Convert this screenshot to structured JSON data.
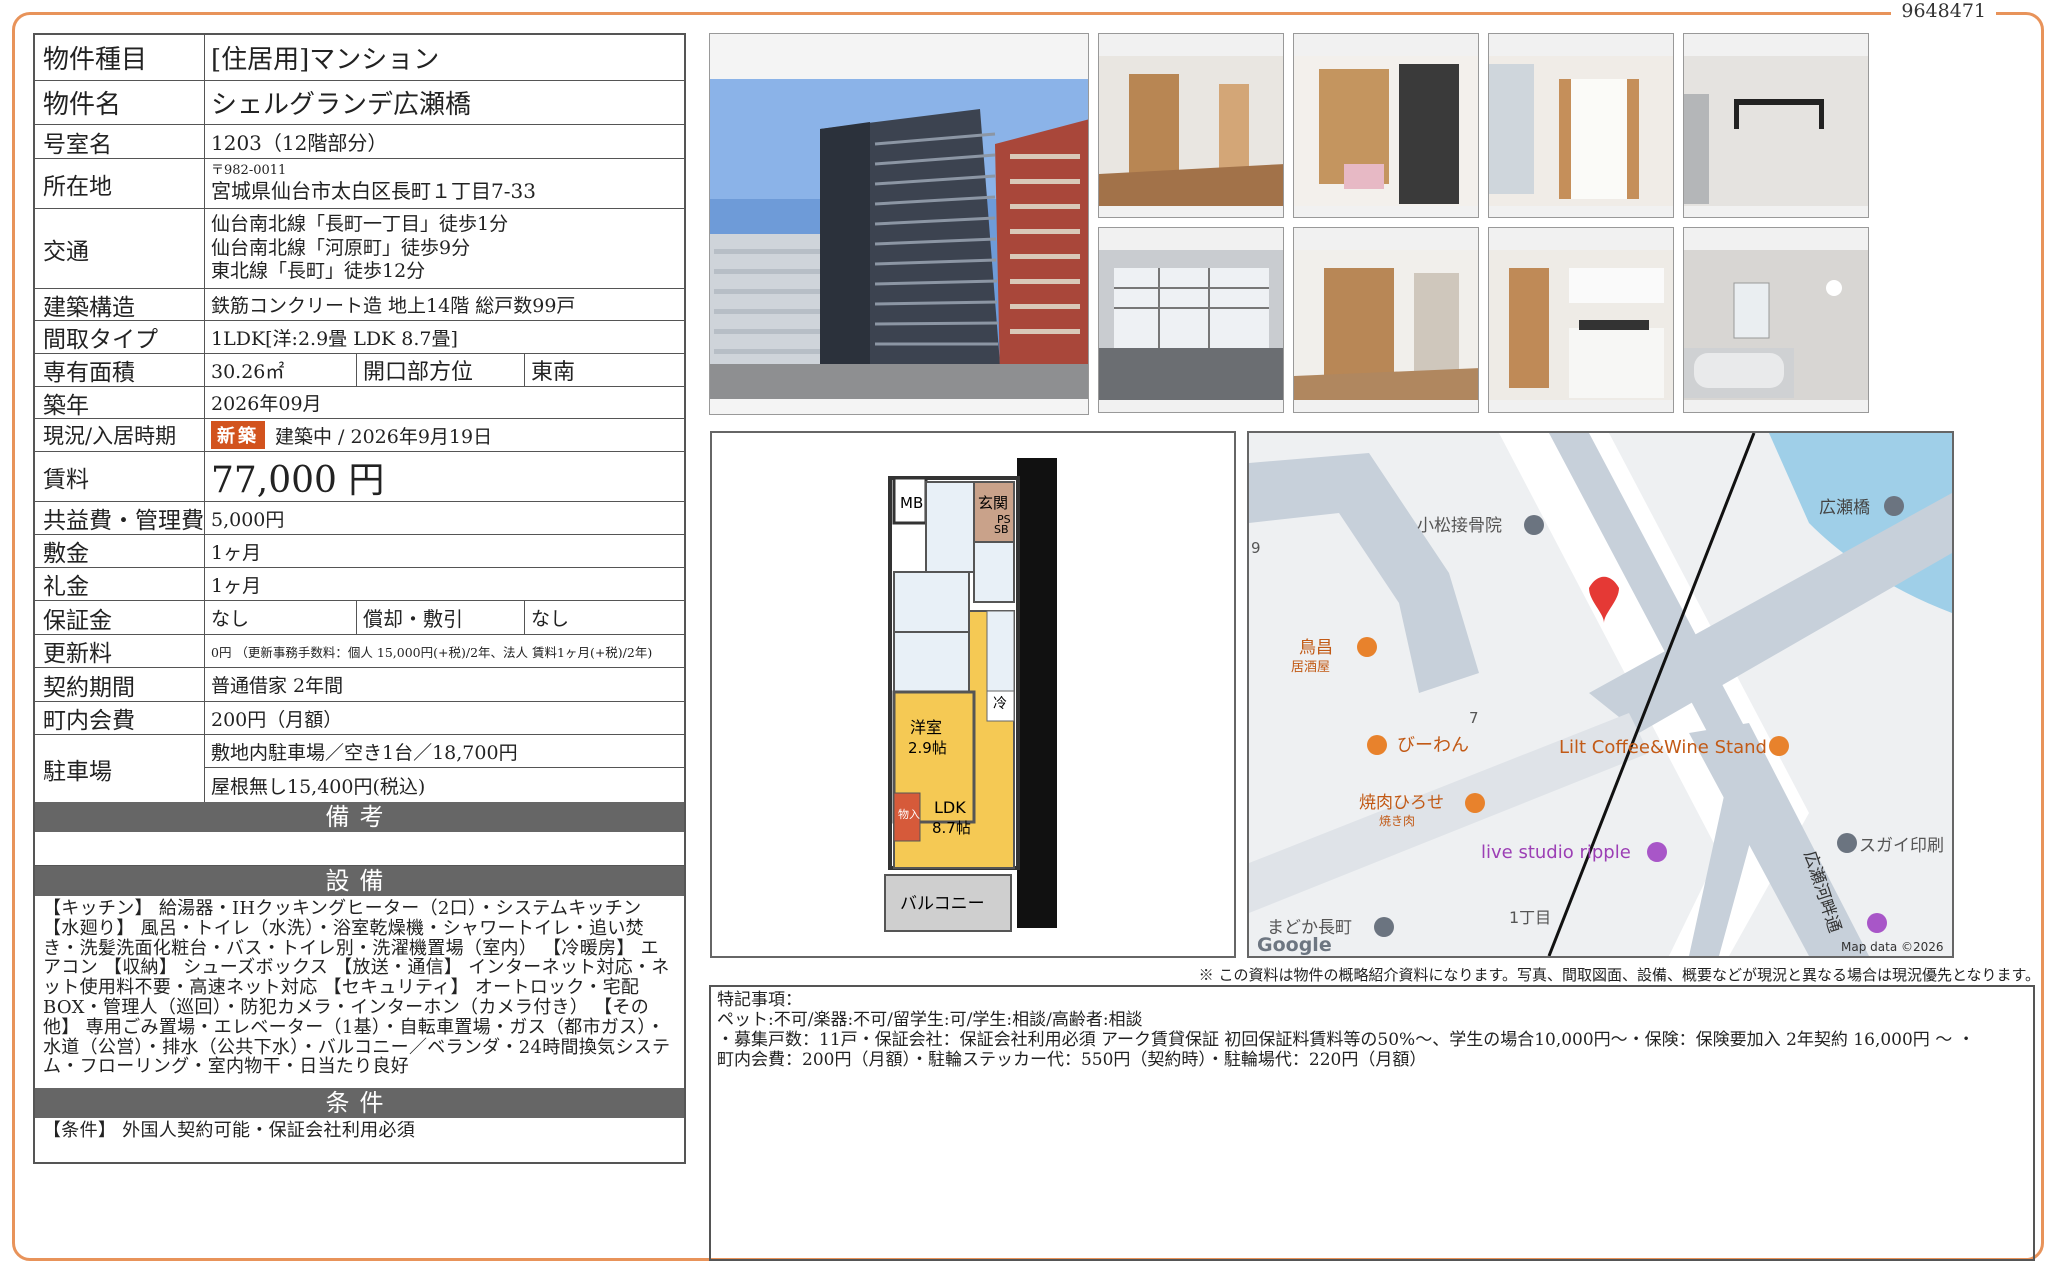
{
  "doc_id": "9648471",
  "property": {
    "type_label": "物件種目",
    "type_value": "[住居用]マンション",
    "name_label": "物件名",
    "name_value": "シェルグランデ広瀬橋",
    "room_label": "号室名",
    "room_value": "1203（12階部分）",
    "address_label": "所在地",
    "address_zip": "〒982-0011",
    "address_value": "宮城県仙台市太白区長町１丁目7-33",
    "access_label": "交通",
    "access_lines": [
      "仙台南北線「長町一丁目」徒歩1分",
      "仙台南北線「河原町」徒歩9分",
      "東北線「長町」徒歩12分"
    ],
    "structure_label": "建築構造",
    "structure_value": "鉄筋コンクリート造 地上14階 総戸数99戸",
    "layout_label": "間取タイプ",
    "layout_value": "1LDK[洋:2.9畳 LDK 8.7畳]",
    "area_label": "専有面積",
    "area_value": "30.26㎡",
    "direction_label": "開口部方位",
    "direction_value": "東南",
    "built_label": "築年",
    "built_value": "2026年09月",
    "status_label": "現況/入居時期",
    "status_badge": "新築",
    "status_value": "建築中 / 2026年9月19日",
    "rent_label": "賃料",
    "rent_value": "77,000 円",
    "fee_label": "共益費・管理費",
    "fee_value": "5,000円",
    "deposit_label": "敷金",
    "deposit_value": "1ヶ月",
    "key_label": "礼金",
    "key_value": "1ヶ月",
    "guarantee_label": "保証金",
    "guarantee_value": "なし",
    "amort_label": "償却・敷引",
    "amort_value": "なし",
    "renew_label": "更新料",
    "renew_value": "0円 （更新事務手数料：個人 15,000円(+税)/2年、法人 賃料1ヶ月(+税)/2年)",
    "contract_label": "契約期間",
    "contract_value": "普通借家 2年間",
    "town_label": "町内会費",
    "town_value": "200円（月額）",
    "parking_label": "駐車場",
    "parking_line1": "敷地内駐車場／空き1台／18,700円",
    "parking_line2": "屋根無し15,400円(税込)"
  },
  "sections": {
    "remarks": "備考",
    "facilities": "設備",
    "conditions": "条件"
  },
  "facilities_text": "【キッチン】 給湯器・IHクッキングヒーター（2口）・システムキッチン 【水廻り】 風呂・トイレ（水洗）・浴室乾燥機・シャワートイレ・追い焚き・洗髪洗面化粧台・バス・トイレ別・洗濯機置場（室内） 【冷暖房】 エアコン 【収納】 シューズボックス 【放送・通信】 インターネット対応・ネット使用料不要・高速ネット対応 【セキュリティ】 オートロック・宅配BOX・管理人（巡回）・防犯カメラ・インターホン（カメラ付き） 【その他】 専用ごみ置場・エレベーター（1基）・自転車置場・ガス（都市ガス）・水道（公営）・排水（公共下水）・バルコニー／ベランダ・24時間換気システム・フローリング・室内物干・日当たり良好",
  "conditions_text": "【条件】 外国人契約可能・保証会社利用必須",
  "floorplan": {
    "mb": "MB",
    "entrance": "玄関",
    "sb": "SB",
    "ps": "PS",
    "western": "洋室",
    "western_size": "2.9帖",
    "ldk": "LDK",
    "ldk_size": "8.7帖",
    "fridge": "冷",
    "closet": "物入",
    "balcony": "バルコニー"
  },
  "map": {
    "komatsu": "小松接骨院",
    "hirosebashi": "広瀬橋",
    "torimasa": "鳥昌",
    "izakaya": "居酒屋",
    "biwan": "びーわん",
    "lilt": "Lilt Coffee&Wine Stand",
    "yakiniku": "焼肉ひろせ",
    "yakiniku_sub": "焼き肉",
    "live": "live studio ripple",
    "sugai": "スガイ印刷",
    "madoka": "まどか長町",
    "chome": "1丁目",
    "road": "広瀬河畔通",
    "num7": "7",
    "num9": "9",
    "google": "Google",
    "mapdata": "Map data ©2026"
  },
  "disclaimer": "※ この資料は物件の概略紹介資料になります。写真、間取図面、設備、概要などが現況と異なる場合は現況優先となります。",
  "tokki": {
    "title": "特記事項：",
    "line1": "ペット:不可/楽器:不可/留学生:可/学生:相談/高齢者:相談",
    "line2": "・募集戸数：11戸・保証会社：保証会社利用必須 アーク賃貸保証 初回保証料賃料等の50%～、学生の場合10,000円～・保険：保険要加入 2年契約 16,000円 ～ ・",
    "line3": "町内会費：200円（月額）・駐輪ステッカー代：550円（契約時）・駐輪場代：220円（月額）"
  }
}
